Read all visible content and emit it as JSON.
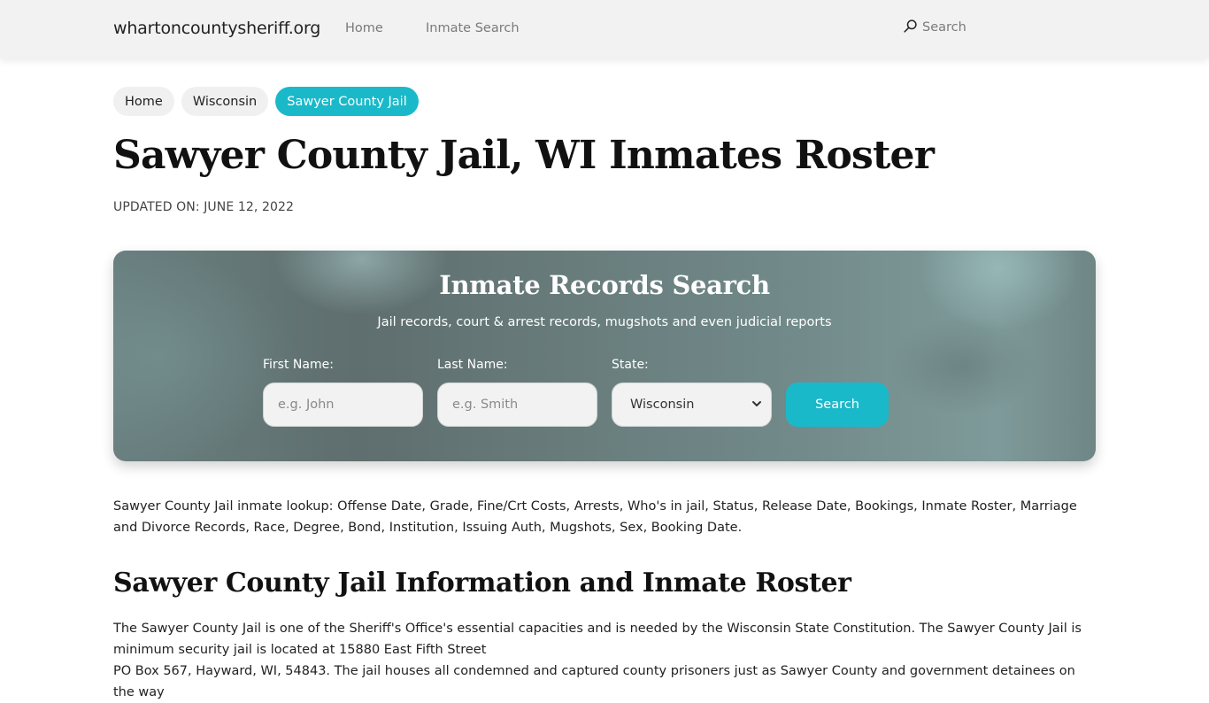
{
  "header": {
    "brand": "whartoncountysheriff.org",
    "nav": [
      {
        "label": "Home"
      },
      {
        "label": "Inmate Search"
      }
    ],
    "search_label": "Search",
    "search_icon": "search-icon"
  },
  "breadcrumb": [
    {
      "label": "Home",
      "active": false
    },
    {
      "label": "Wisconsin",
      "active": false
    },
    {
      "label": "Sawyer County Jail",
      "active": true
    }
  ],
  "page": {
    "title": "Sawyer County Jail, WI Inmates Roster",
    "updated": "UPDATED ON: JUNE 12, 2022"
  },
  "search_card": {
    "title": "Inmate Records Search",
    "subtitle": "Jail records, court & arrest records, mugshots and even judicial reports",
    "first_name": {
      "label": "First Name:",
      "placeholder": "e.g. John",
      "value": ""
    },
    "last_name": {
      "label": "Last Name:",
      "placeholder": "e.g. Smith",
      "value": ""
    },
    "state": {
      "label": "State:",
      "selected": "Wisconsin"
    },
    "button_label": "Search"
  },
  "content": {
    "intro": "Sawyer County Jail inmate lookup: Offense Date, Grade, Fine/Crt Costs, Arrests, Who's in jail, Status, Release Date, Bookings, Inmate Roster, Marriage and Divorce Records, Race, Degree, Bond, Institution, Issuing Auth, Mugshots, Sex, Booking Date.",
    "section_title": "Sawyer County Jail Information and Inmate Roster",
    "paragraph_lines": [
      "The Sawyer County Jail is one of the Sheriff's Office's essential capacities and is needed by the Wisconsin State Constitution. The Sawyer County Jail is minimum security jail is located at 15880 East Fifth Street",
      "PO Box 567, Hayward, WI, 54843. The jail houses all condemned and captured county prisoners just as Sawyer County and government detainees on the way"
    ]
  },
  "colors": {
    "accent": "#1ab9c9",
    "header_bg": "#f2f2f2",
    "chip_bg": "#f0f0f0"
  }
}
